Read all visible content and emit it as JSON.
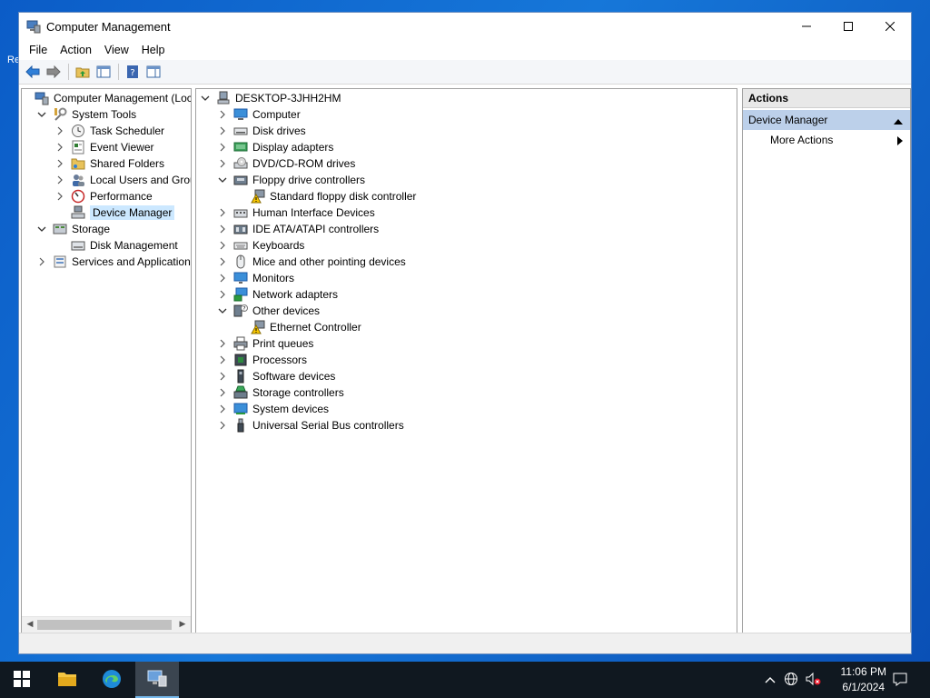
{
  "window": {
    "title": "Computer Management"
  },
  "menu": [
    "File",
    "Action",
    "View",
    "Help"
  ],
  "left_tree": [
    {
      "label": "Computer Management (Local",
      "level": 0,
      "chevron": "",
      "icon": "computer-management-icon"
    },
    {
      "label": "System Tools",
      "level": 1,
      "chevron": "down",
      "icon": "system-tools-icon"
    },
    {
      "label": "Task Scheduler",
      "level": 2,
      "chevron": "right",
      "icon": "task-scheduler-icon"
    },
    {
      "label": "Event Viewer",
      "level": 2,
      "chevron": "right",
      "icon": "event-viewer-icon"
    },
    {
      "label": "Shared Folders",
      "level": 2,
      "chevron": "right",
      "icon": "shared-folders-icon"
    },
    {
      "label": "Local Users and Groups",
      "level": 2,
      "chevron": "right",
      "icon": "users-groups-icon"
    },
    {
      "label": "Performance",
      "level": 2,
      "chevron": "right",
      "icon": "performance-icon"
    },
    {
      "label": "Device Manager",
      "level": 2,
      "chevron": "",
      "icon": "device-manager-icon",
      "selected": true
    },
    {
      "label": "Storage",
      "level": 1,
      "chevron": "down",
      "icon": "storage-icon"
    },
    {
      "label": "Disk Management",
      "level": 2,
      "chevron": "",
      "icon": "disk-management-icon"
    },
    {
      "label": "Services and Applications",
      "level": 1,
      "chevron": "right",
      "icon": "services-icon"
    }
  ],
  "device_tree": [
    {
      "label": "DESKTOP-3JHH2HM",
      "level": 0,
      "chevron": "down",
      "icon": "desktop-computer-icon"
    },
    {
      "label": "Computer",
      "level": 1,
      "chevron": "right",
      "icon": "computer-icon"
    },
    {
      "label": "Disk drives",
      "level": 1,
      "chevron": "right",
      "icon": "disk-drive-icon"
    },
    {
      "label": "Display adapters",
      "level": 1,
      "chevron": "right",
      "icon": "display-adapter-icon"
    },
    {
      "label": "DVD/CD-ROM drives",
      "level": 1,
      "chevron": "right",
      "icon": "dvd-drive-icon"
    },
    {
      "label": "Floppy drive controllers",
      "level": 1,
      "chevron": "down",
      "icon": "floppy-controller-icon"
    },
    {
      "label": "Standard floppy disk controller",
      "level": 2,
      "chevron": "",
      "icon": "warning-device-icon"
    },
    {
      "label": "Human Interface Devices",
      "level": 1,
      "chevron": "right",
      "icon": "hid-icon"
    },
    {
      "label": "IDE ATA/ATAPI controllers",
      "level": 1,
      "chevron": "right",
      "icon": "ide-controller-icon"
    },
    {
      "label": "Keyboards",
      "level": 1,
      "chevron": "right",
      "icon": "keyboard-icon"
    },
    {
      "label": "Mice and other pointing devices",
      "level": 1,
      "chevron": "right",
      "icon": "mouse-icon"
    },
    {
      "label": "Monitors",
      "level": 1,
      "chevron": "right",
      "icon": "monitor-icon"
    },
    {
      "label": "Network adapters",
      "level": 1,
      "chevron": "right",
      "icon": "network-adapter-icon"
    },
    {
      "label": "Other devices",
      "level": 1,
      "chevron": "down",
      "icon": "other-devices-icon"
    },
    {
      "label": "Ethernet Controller",
      "level": 2,
      "chevron": "",
      "icon": "warning-device-icon"
    },
    {
      "label": "Print queues",
      "level": 1,
      "chevron": "right",
      "icon": "printer-icon"
    },
    {
      "label": "Processors",
      "level": 1,
      "chevron": "right",
      "icon": "processor-icon"
    },
    {
      "label": "Software devices",
      "level": 1,
      "chevron": "right",
      "icon": "software-device-icon"
    },
    {
      "label": "Storage controllers",
      "level": 1,
      "chevron": "right",
      "icon": "storage-controller-icon"
    },
    {
      "label": "System devices",
      "level": 1,
      "chevron": "right",
      "icon": "system-devices-icon"
    },
    {
      "label": "Universal Serial Bus controllers",
      "level": 1,
      "chevron": "right",
      "icon": "usb-icon"
    }
  ],
  "actions": {
    "header": "Actions",
    "section": "Device Manager",
    "items": [
      "More Actions"
    ]
  },
  "desktop": {
    "partial_label": "Re"
  },
  "taskbar": {
    "time": "11:06 PM",
    "date": "6/1/2024"
  },
  "colors": {
    "selection": "#cce8ff",
    "actions_section": "#bcd0ea",
    "taskbar": "#101820"
  }
}
